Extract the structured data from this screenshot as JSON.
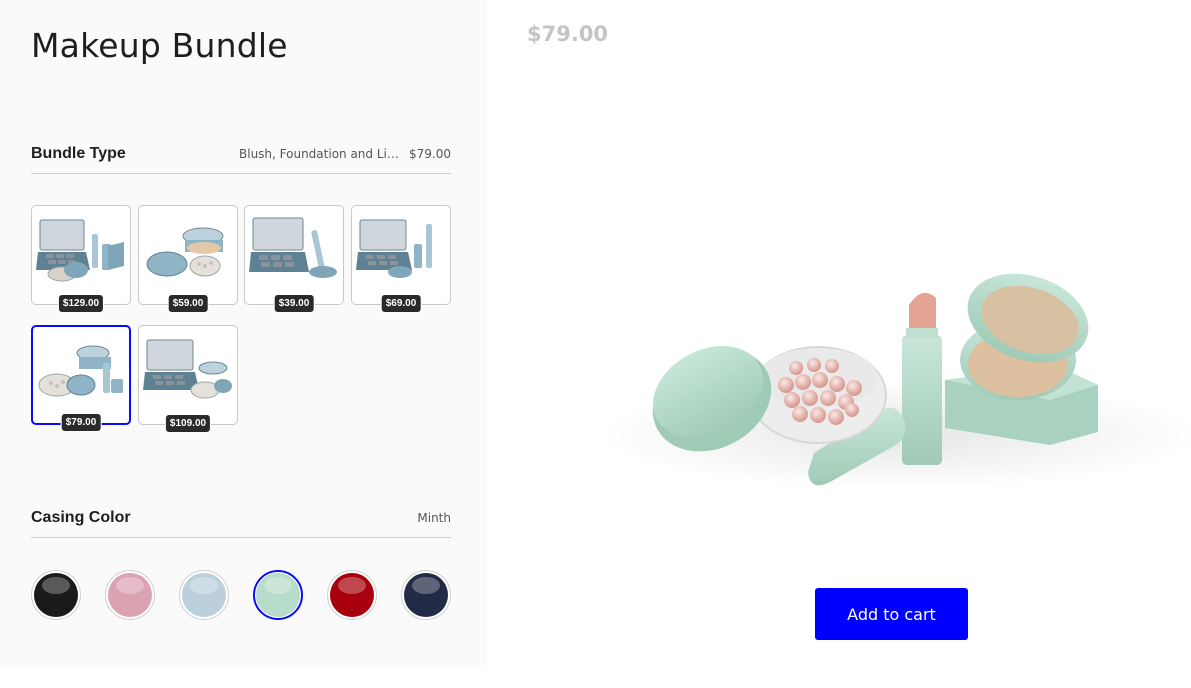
{
  "product": {
    "title": "Makeup Bundle",
    "price": "$79.00"
  },
  "bundle_type": {
    "label": "Bundle Type",
    "selected_name": "Blush, Foundation and Lipstick",
    "selected_price": "$79.00",
    "options": [
      {
        "price": "$129.00"
      },
      {
        "price": "$59.00"
      },
      {
        "price": "$39.00"
      },
      {
        "price": "$69.00"
      },
      {
        "price": "$79.00",
        "selected": true
      },
      {
        "price": "$109.00"
      }
    ]
  },
  "casing_color": {
    "label": "Casing Color",
    "selected_name": "Minth",
    "swatches": [
      {
        "color": "#1a1a1a"
      },
      {
        "color": "#dba3b2"
      },
      {
        "color": "#bcd0dc"
      },
      {
        "color": "#b8dcca",
        "selected": true
      },
      {
        "color": "#a8000c"
      },
      {
        "color": "#222a45"
      }
    ]
  },
  "actions": {
    "add_to_cart": "Add to cart"
  }
}
